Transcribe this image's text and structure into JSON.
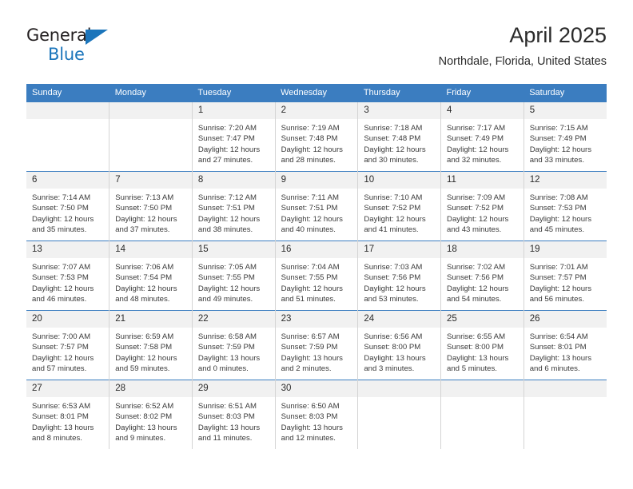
{
  "brand": {
    "name_part1": "General",
    "name_part2": "Blue",
    "accent_color": "#1b75bb"
  },
  "header": {
    "title": "April 2025",
    "subtitle": "Northdale, Florida, United States"
  },
  "theme": {
    "header_blue": "#3b7dc0",
    "daynum_band": "#f1f1f1",
    "grid_line": "#d4d4d4"
  },
  "calendar": {
    "weekday_headers": [
      "Sunday",
      "Monday",
      "Tuesday",
      "Wednesday",
      "Thursday",
      "Friday",
      "Saturday"
    ],
    "weeks": [
      [
        {
          "day": "",
          "sunrise": "",
          "sunset": "",
          "daylight": "",
          "empty": true
        },
        {
          "day": "",
          "sunrise": "",
          "sunset": "",
          "daylight": "",
          "empty": true
        },
        {
          "day": "1",
          "sunrise": "Sunrise: 7:20 AM",
          "sunset": "Sunset: 7:47 PM",
          "daylight": "Daylight: 12 hours and 27 minutes."
        },
        {
          "day": "2",
          "sunrise": "Sunrise: 7:19 AM",
          "sunset": "Sunset: 7:48 PM",
          "daylight": "Daylight: 12 hours and 28 minutes."
        },
        {
          "day": "3",
          "sunrise": "Sunrise: 7:18 AM",
          "sunset": "Sunset: 7:48 PM",
          "daylight": "Daylight: 12 hours and 30 minutes."
        },
        {
          "day": "4",
          "sunrise": "Sunrise: 7:17 AM",
          "sunset": "Sunset: 7:49 PM",
          "daylight": "Daylight: 12 hours and 32 minutes."
        },
        {
          "day": "5",
          "sunrise": "Sunrise: 7:15 AM",
          "sunset": "Sunset: 7:49 PM",
          "daylight": "Daylight: 12 hours and 33 minutes."
        }
      ],
      [
        {
          "day": "6",
          "sunrise": "Sunrise: 7:14 AM",
          "sunset": "Sunset: 7:50 PM",
          "daylight": "Daylight: 12 hours and 35 minutes."
        },
        {
          "day": "7",
          "sunrise": "Sunrise: 7:13 AM",
          "sunset": "Sunset: 7:50 PM",
          "daylight": "Daylight: 12 hours and 37 minutes."
        },
        {
          "day": "8",
          "sunrise": "Sunrise: 7:12 AM",
          "sunset": "Sunset: 7:51 PM",
          "daylight": "Daylight: 12 hours and 38 minutes."
        },
        {
          "day": "9",
          "sunrise": "Sunrise: 7:11 AM",
          "sunset": "Sunset: 7:51 PM",
          "daylight": "Daylight: 12 hours and 40 minutes."
        },
        {
          "day": "10",
          "sunrise": "Sunrise: 7:10 AM",
          "sunset": "Sunset: 7:52 PM",
          "daylight": "Daylight: 12 hours and 41 minutes."
        },
        {
          "day": "11",
          "sunrise": "Sunrise: 7:09 AM",
          "sunset": "Sunset: 7:52 PM",
          "daylight": "Daylight: 12 hours and 43 minutes."
        },
        {
          "day": "12",
          "sunrise": "Sunrise: 7:08 AM",
          "sunset": "Sunset: 7:53 PM",
          "daylight": "Daylight: 12 hours and 45 minutes."
        }
      ],
      [
        {
          "day": "13",
          "sunrise": "Sunrise: 7:07 AM",
          "sunset": "Sunset: 7:53 PM",
          "daylight": "Daylight: 12 hours and 46 minutes."
        },
        {
          "day": "14",
          "sunrise": "Sunrise: 7:06 AM",
          "sunset": "Sunset: 7:54 PM",
          "daylight": "Daylight: 12 hours and 48 minutes."
        },
        {
          "day": "15",
          "sunrise": "Sunrise: 7:05 AM",
          "sunset": "Sunset: 7:55 PM",
          "daylight": "Daylight: 12 hours and 49 minutes."
        },
        {
          "day": "16",
          "sunrise": "Sunrise: 7:04 AM",
          "sunset": "Sunset: 7:55 PM",
          "daylight": "Daylight: 12 hours and 51 minutes."
        },
        {
          "day": "17",
          "sunrise": "Sunrise: 7:03 AM",
          "sunset": "Sunset: 7:56 PM",
          "daylight": "Daylight: 12 hours and 53 minutes."
        },
        {
          "day": "18",
          "sunrise": "Sunrise: 7:02 AM",
          "sunset": "Sunset: 7:56 PM",
          "daylight": "Daylight: 12 hours and 54 minutes."
        },
        {
          "day": "19",
          "sunrise": "Sunrise: 7:01 AM",
          "sunset": "Sunset: 7:57 PM",
          "daylight": "Daylight: 12 hours and 56 minutes."
        }
      ],
      [
        {
          "day": "20",
          "sunrise": "Sunrise: 7:00 AM",
          "sunset": "Sunset: 7:57 PM",
          "daylight": "Daylight: 12 hours and 57 minutes."
        },
        {
          "day": "21",
          "sunrise": "Sunrise: 6:59 AM",
          "sunset": "Sunset: 7:58 PM",
          "daylight": "Daylight: 12 hours and 59 minutes."
        },
        {
          "day": "22",
          "sunrise": "Sunrise: 6:58 AM",
          "sunset": "Sunset: 7:59 PM",
          "daylight": "Daylight: 13 hours and 0 minutes."
        },
        {
          "day": "23",
          "sunrise": "Sunrise: 6:57 AM",
          "sunset": "Sunset: 7:59 PM",
          "daylight": "Daylight: 13 hours and 2 minutes."
        },
        {
          "day": "24",
          "sunrise": "Sunrise: 6:56 AM",
          "sunset": "Sunset: 8:00 PM",
          "daylight": "Daylight: 13 hours and 3 minutes."
        },
        {
          "day": "25",
          "sunrise": "Sunrise: 6:55 AM",
          "sunset": "Sunset: 8:00 PM",
          "daylight": "Daylight: 13 hours and 5 minutes."
        },
        {
          "day": "26",
          "sunrise": "Sunrise: 6:54 AM",
          "sunset": "Sunset: 8:01 PM",
          "daylight": "Daylight: 13 hours and 6 minutes."
        }
      ],
      [
        {
          "day": "27",
          "sunrise": "Sunrise: 6:53 AM",
          "sunset": "Sunset: 8:01 PM",
          "daylight": "Daylight: 13 hours and 8 minutes."
        },
        {
          "day": "28",
          "sunrise": "Sunrise: 6:52 AM",
          "sunset": "Sunset: 8:02 PM",
          "daylight": "Daylight: 13 hours and 9 minutes."
        },
        {
          "day": "29",
          "sunrise": "Sunrise: 6:51 AM",
          "sunset": "Sunset: 8:03 PM",
          "daylight": "Daylight: 13 hours and 11 minutes."
        },
        {
          "day": "30",
          "sunrise": "Sunrise: 6:50 AM",
          "sunset": "Sunset: 8:03 PM",
          "daylight": "Daylight: 13 hours and 12 minutes."
        },
        {
          "day": "",
          "sunrise": "",
          "sunset": "",
          "daylight": "",
          "empty": true
        },
        {
          "day": "",
          "sunrise": "",
          "sunset": "",
          "daylight": "",
          "empty": true
        },
        {
          "day": "",
          "sunrise": "",
          "sunset": "",
          "daylight": "",
          "empty": true
        }
      ]
    ]
  }
}
